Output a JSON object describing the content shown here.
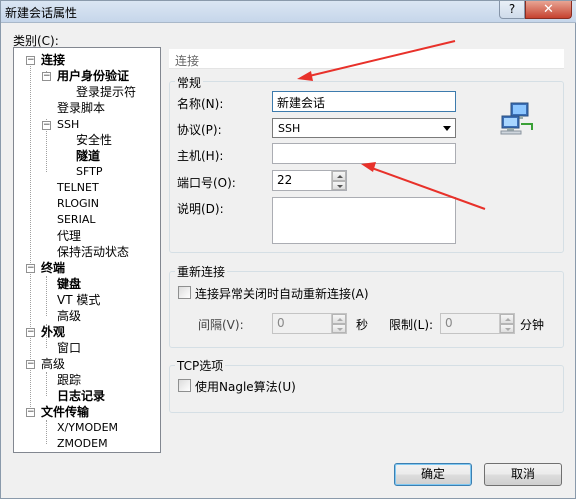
{
  "window": {
    "title": "新建会话属性",
    "help_glyph": "?",
    "close_glyph": "✕"
  },
  "category_label": "类别(C):",
  "tree": {
    "items": [
      {
        "label": "连接"
      },
      {
        "label": "用户身份验证"
      },
      {
        "label": "登录提示符"
      },
      {
        "label": "登录脚本"
      },
      {
        "label": "SSH"
      },
      {
        "label": "安全性"
      },
      {
        "label": "隧道"
      },
      {
        "label": "SFTP"
      },
      {
        "label": "TELNET"
      },
      {
        "label": "RLOGIN"
      },
      {
        "label": "SERIAL"
      },
      {
        "label": "代理"
      },
      {
        "label": "保持活动状态"
      },
      {
        "label": "终端"
      },
      {
        "label": "键盘"
      },
      {
        "label": "VT 模式"
      },
      {
        "label": "高级"
      },
      {
        "label": "外观"
      },
      {
        "label": "窗口"
      },
      {
        "label": "高级"
      },
      {
        "label": "跟踪"
      },
      {
        "label": "日志记录"
      },
      {
        "label": "文件传输"
      },
      {
        "label": "X/YMODEM"
      },
      {
        "label": "ZMODEM"
      }
    ],
    "expander_minus": "−"
  },
  "panel": {
    "header": "连接",
    "general": {
      "title": "常规",
      "name_label": "名称(N):",
      "name_value": "新建会话",
      "protocol_label": "协议(P):",
      "protocol_value": "SSH",
      "host_label": "主机(H):",
      "host_value": "",
      "port_label": "端口号(O):",
      "port_value": "22",
      "desc_label": "说明(D):",
      "desc_value": ""
    },
    "reconnect": {
      "title": "重新连接",
      "checkbox_label": "连接异常关闭时自动重新连接(A)",
      "interval_label": "间隔(V):",
      "interval_value": "0",
      "interval_unit": "秒",
      "limit_label": "限制(L):",
      "limit_value": "0",
      "limit_unit": "分钟"
    },
    "tcp": {
      "title": "TCP选项",
      "nagle_label": "使用Nagle算法(U)"
    }
  },
  "buttons": {
    "ok": "确定",
    "cancel": "取消"
  },
  "colors": {
    "annotation_arrow": "#e8312a"
  }
}
